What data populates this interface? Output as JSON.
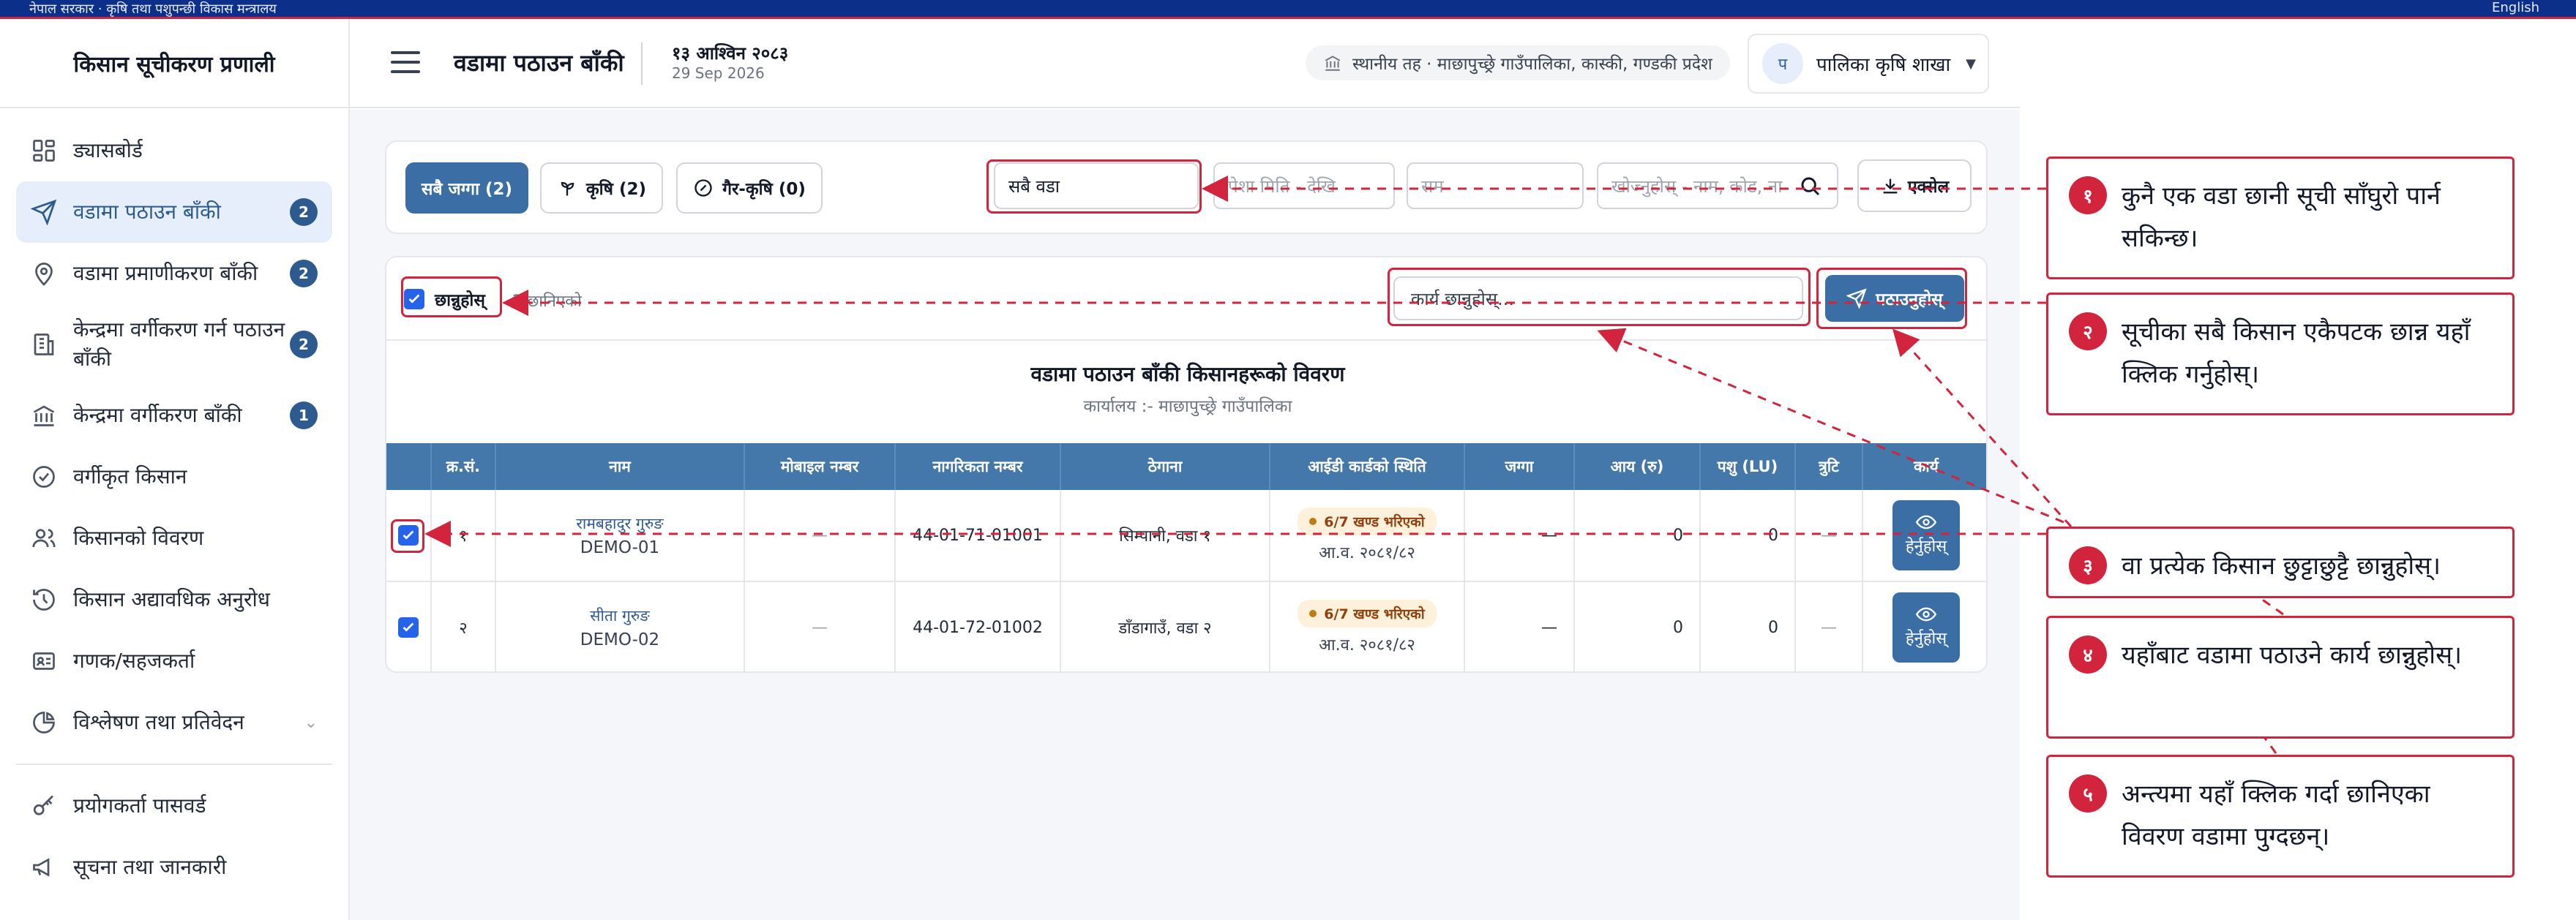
{
  "top_strip": {
    "left_text": "नेपाल सरकार · कृषि तथा पशुपन्छी विकास मन्त्रालय",
    "right_text": "English"
  },
  "brand": {
    "title": "किसान सूचीकरण प्रणाली"
  },
  "sidebar": {
    "items": [
      {
        "label": "ड्यासबोर्ड",
        "icon": "dashboard-icon",
        "badge": ""
      },
      {
        "label": "वडामा पठाउन बाँकी",
        "icon": "send-icon",
        "badge": "2",
        "active": true
      },
      {
        "label": "वडामा प्रमाणीकरण बाँकी",
        "icon": "location-pin-icon",
        "badge": "2"
      },
      {
        "label": "केन्द्रमा वर्गीकरण गर्न पठाउन बाँकी",
        "icon": "building-icon",
        "badge": "2"
      },
      {
        "label": "केन्द्रमा वर्गीकरण बाँकी",
        "icon": "bank-icon",
        "badge": "1"
      },
      {
        "label": "वर्गीकृत किसान",
        "icon": "check-circle-icon",
        "badge": ""
      },
      {
        "label": "किसानको विवरण",
        "icon": "users-icon",
        "badge": ""
      },
      {
        "label": "किसान अद्यावधिक अनुरोध",
        "icon": "history-icon",
        "badge": ""
      },
      {
        "label": "गणक/सहजकर्ता",
        "icon": "id-card-icon",
        "badge": ""
      },
      {
        "label": "विश्लेषण तथा प्रतिवेदन",
        "icon": "pie-chart-icon",
        "badge": ""
      }
    ],
    "bottom_items": [
      {
        "label": "प्रयोगकर्ता पासवर्ड",
        "icon": "key-icon"
      },
      {
        "label": "सूचना तथा जानकारी",
        "icon": "megaphone-icon"
      }
    ]
  },
  "header": {
    "title": "वडामा पठाउन बाँकी",
    "date_np": "१३ आश्विन २०८३",
    "date_en": "29 Sep 2026",
    "office": "स्थानीय तह · माछापुच्छ्रे गाउँपालिका, कास्की, गण्डकी प्रदेश",
    "user_initial": "प",
    "user_name": "पालिका कृषि शाखा"
  },
  "filters": {
    "tabs": [
      {
        "label": "सबै जग्गा (2)",
        "active": true
      },
      {
        "label": "कृषि (2)",
        "icon": "sprout-icon"
      },
      {
        "label": "गैर-कृषि (0)",
        "icon": "slash-circle-icon"
      }
    ],
    "ward_value": "सबै वडा",
    "occupation_placeholder": "पेशा मिति - देखि",
    "type_placeholder": "सम",
    "search_placeholder": "खोज्नुहोस् - नाम, कोड, ना",
    "excel_label": "एक्सेल"
  },
  "selection": {
    "select_all_label": "छान्नुहोस्",
    "selected_count": "2 छानिएको",
    "action_placeholder": "कार्य छान्नुहोस्...",
    "send_label": "पठाउनुहोस्"
  },
  "report": {
    "title": "वडामा पठाउन बाँकी किसानहरूको विवरण",
    "subtitle": "कार्यालय :- माछापुच्छ्रे गाउँपालिका"
  },
  "table": {
    "headers": [
      "",
      "क्र.सं.",
      "नाम",
      "मोबाइल नम्बर",
      "नागरिकता नम्बर",
      "ठेगाना",
      "आईडी कार्डको स्थिति",
      "जग्गा",
      "आय (रु)",
      "पशु (LU)",
      "त्रुटि",
      "कार्य"
    ],
    "rows": [
      {
        "sn": "१",
        "name_np": "रामबहादुर गुरुङ",
        "name_code": "DEMO-01",
        "mobile": "—",
        "citizenship": "44-01-71-01001",
        "address": "सिम्पानी, वडा १",
        "id_status": "6/7 खण्ड भरिएको",
        "id_date": "आ.व. २०८१/८२",
        "land": "—",
        "income": "0",
        "livestock": "0",
        "error": "—",
        "action": "हेर्नुहोस्"
      },
      {
        "sn": "२",
        "name_np": "सीता गुरुङ",
        "name_code": "DEMO-02",
        "mobile": "—",
        "citizenship": "44-01-72-01002",
        "address": "डाँडागाउँ, वडा २",
        "id_status": "6/7 खण्ड भरिएको",
        "id_date": "आ.व. २०८१/८२",
        "land": "—",
        "income": "0",
        "livestock": "0",
        "error": "—",
        "action": "हेर्नुहोस्"
      }
    ]
  },
  "callouts": [
    {
      "num": "१",
      "text": "कुनै एक वडा छानी सूची साँघुरो पार्न सकिन्छ।"
    },
    {
      "num": "२",
      "text": "सूचीका सबै किसान एकैपटक छान्न यहाँ क्लिक गर्नुहोस्।"
    },
    {
      "num": "३",
      "text": "वा प्रत्येक किसान छुट्टाछुट्टै छान्नुहोस्।"
    },
    {
      "num": "४",
      "text": "यहाँबाट वडामा पठाउने कार्य छान्नुहोस्।"
    },
    {
      "num": "५",
      "text": "अन्त्यमा यहाँ क्लिक गर्दा छानिएका विवरण वडामा पुग्दछन्।"
    }
  ],
  "colors": {
    "brand_blue": "#3a6ea5",
    "table_header": "#4477aa",
    "annotation_red": "#d2243c",
    "badge_blue": "#2d5b8f"
  }
}
